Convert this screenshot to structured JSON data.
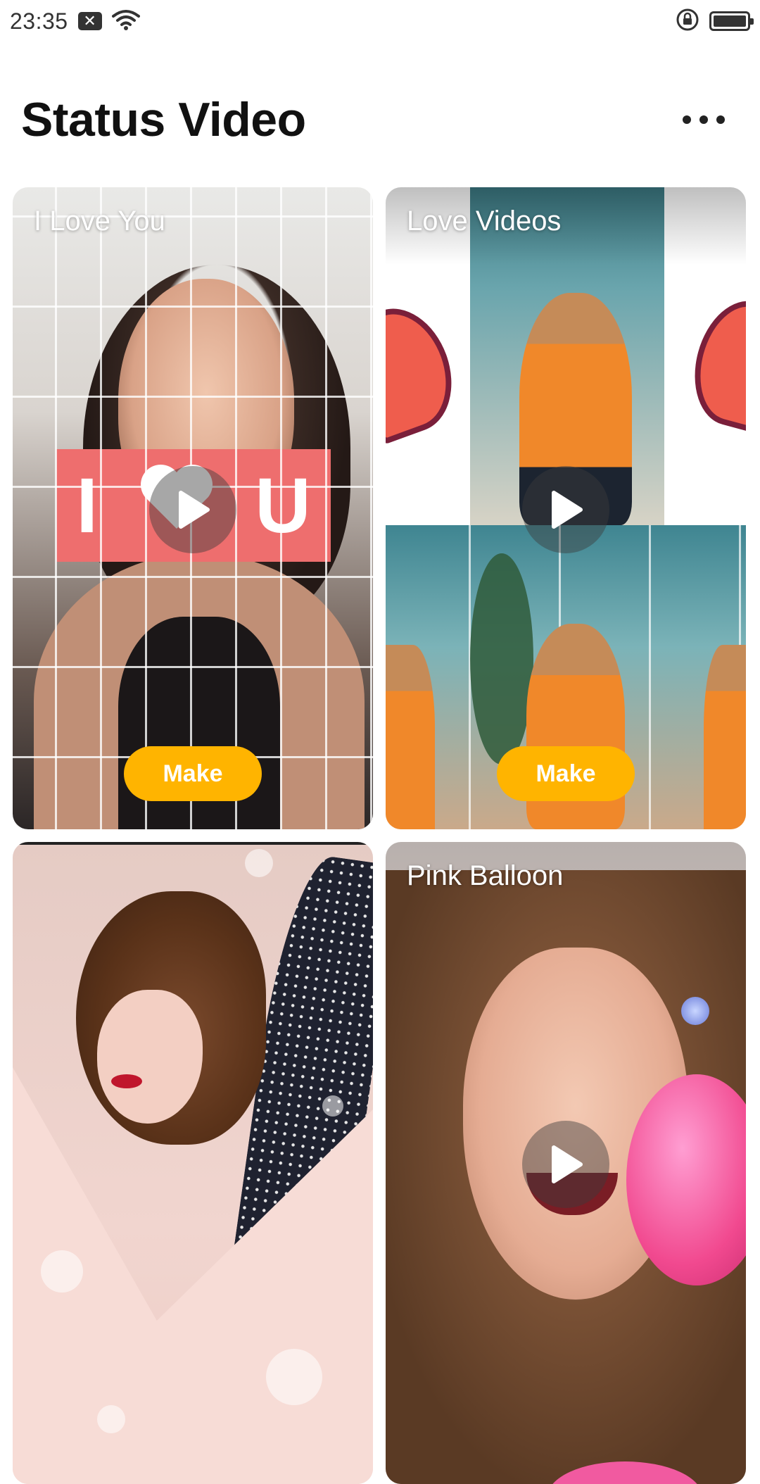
{
  "status_bar": {
    "time": "23:35",
    "icons": [
      "notification-x-icon",
      "wifi-icon",
      "rotation-lock-icon",
      "battery-icon"
    ]
  },
  "header": {
    "title": "Status Video",
    "more_icon": "more-horizontal-icon"
  },
  "cards": [
    {
      "label": "I Love You",
      "banner_left": "I",
      "banner_right": "U",
      "make_label": "Make",
      "has_make": true
    },
    {
      "label": "Love Videos",
      "make_label": "Make",
      "has_make": true
    },
    {
      "label": "",
      "has_make": false
    },
    {
      "label": "Pink Balloon",
      "has_make": false
    }
  ],
  "colors": {
    "accent": "#FFB400",
    "title": "#111111",
    "banner": "#EE6E6E"
  }
}
